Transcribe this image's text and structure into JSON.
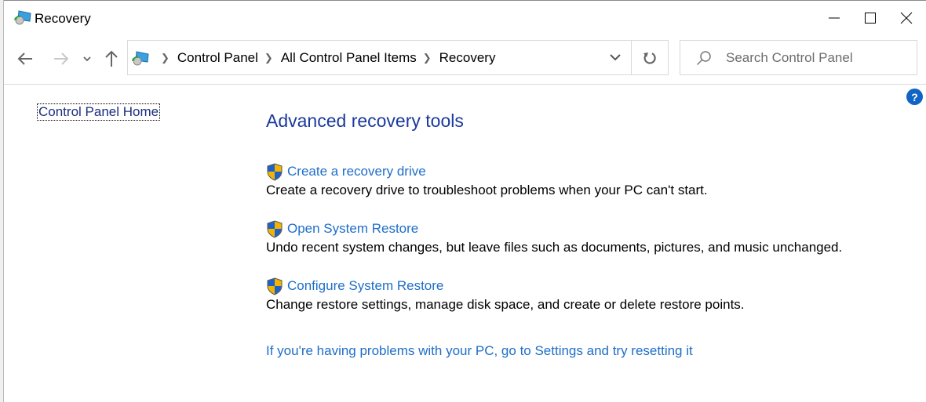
{
  "window": {
    "title": "Recovery",
    "app_icon": "recovery-control-panel-icon",
    "controls": {
      "minimize": "minimize-icon",
      "maximize": "maximize-icon",
      "close": "close-icon"
    }
  },
  "navigation": {
    "back_icon": "back-arrow-icon",
    "forward_icon": "forward-arrow-icon",
    "recent_icon": "chevron-down-icon",
    "up_icon": "up-arrow-icon",
    "breadcrumb": [
      "Control Panel",
      "All Control Panel Items",
      "Recovery"
    ],
    "refresh_icon": "refresh-icon",
    "search": {
      "value": "",
      "placeholder": "Search Control Panel"
    }
  },
  "sidebar": {
    "home_link": "Control Panel Home"
  },
  "help_label": "?",
  "main": {
    "heading": "Advanced recovery tools",
    "tasks": [
      {
        "label": "Create a recovery drive",
        "description": "Create a recovery drive to troubleshoot problems when your PC can't start.",
        "icon": "uac-shield-icon"
      },
      {
        "label": "Open System Restore",
        "description": "Undo recent system changes, but leave files such as documents, pictures, and music unchanged.",
        "icon": "uac-shield-icon"
      },
      {
        "label": "Configure System Restore",
        "description": "Change restore settings, manage disk space, and create or delete restore points.",
        "icon": "uac-shield-icon"
      }
    ],
    "reset_link": "If you're having problems with your PC, go to Settings and try resetting it"
  },
  "colors": {
    "link": "#1e6ec8",
    "heading": "#1a3a9c",
    "help": "#1164c4"
  }
}
